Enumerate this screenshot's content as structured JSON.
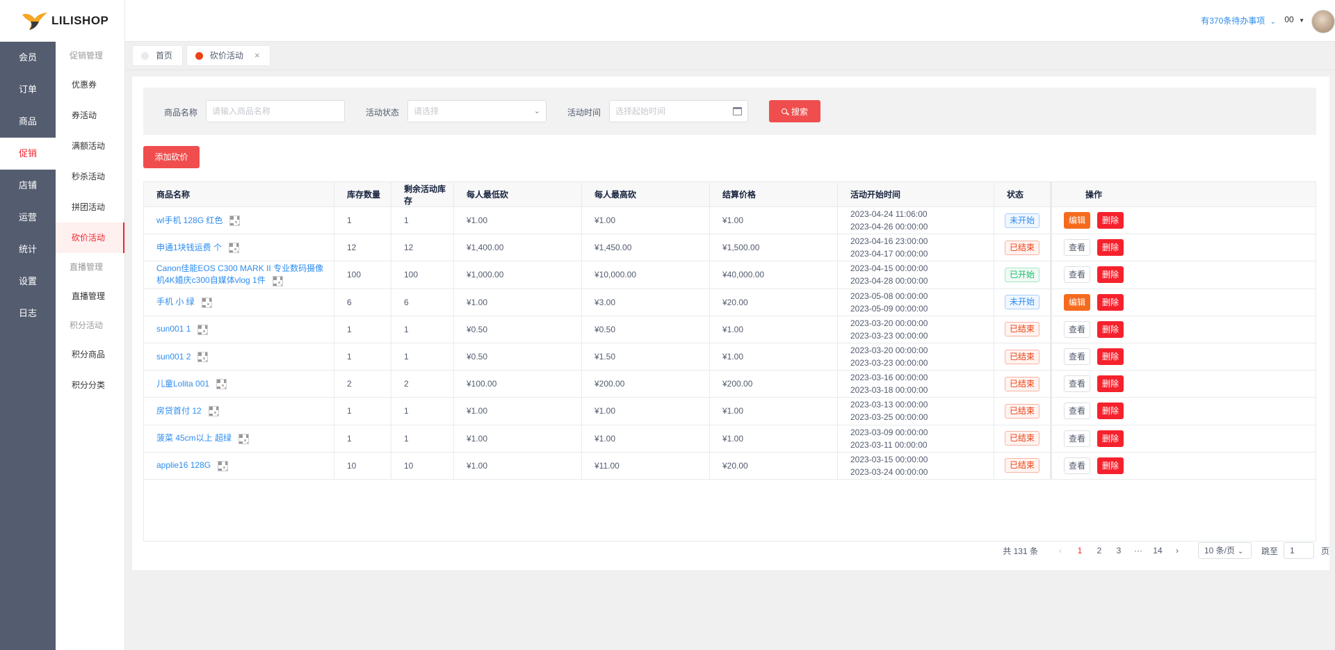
{
  "brand": {
    "name": "LILISHOP"
  },
  "header": {
    "todo": "有370条待办事项",
    "user": "00"
  },
  "nav": {
    "items": [
      {
        "label": "会员",
        "active": false
      },
      {
        "label": "订单",
        "active": false
      },
      {
        "label": "商品",
        "active": false
      },
      {
        "label": "促销",
        "active": true
      },
      {
        "label": "店铺",
        "active": false
      },
      {
        "label": "运营",
        "active": false
      },
      {
        "label": "统计",
        "active": false
      },
      {
        "label": "设置",
        "active": false
      },
      {
        "label": "日志",
        "active": false
      }
    ]
  },
  "subnav": {
    "groups": [
      {
        "title": "促销管理",
        "items": [
          "优惠券",
          "券活动",
          "满额活动",
          "秒杀活动",
          "拼团活动",
          "砍价活动"
        ]
      },
      {
        "title": "直播管理",
        "items": [
          "直播管理"
        ]
      },
      {
        "title": "积分活动",
        "items": [
          "积分商品",
          "积分分类"
        ]
      }
    ],
    "active": "砍价活动"
  },
  "tabs": [
    {
      "label": "首页",
      "closable": false
    },
    {
      "label": "砍价活动",
      "closable": true,
      "close": "×"
    }
  ],
  "search": {
    "name_label": "商品名称",
    "name_placeholder": "请输入商品名称",
    "status_label": "活动状态",
    "status_placeholder": "请选择",
    "time_label": "活动时间",
    "time_placeholder": "选择起始时间",
    "search_button": "搜索"
  },
  "add_button": "添加砍价",
  "table": {
    "columns": [
      "商品名称",
      "库存数量",
      "剩余活动库存",
      "每人最低砍",
      "每人最高砍",
      "结算价格",
      "活动开始时间",
      "状态",
      "操作"
    ],
    "rows": [
      {
        "name": "wl手机 128G 红色",
        "stock": "1",
        "remain": "1",
        "min": "¥1.00",
        "max": "¥1.00",
        "price": "¥1.00",
        "start": "2023-04-24 11:06:00",
        "end": "2023-04-26 00:00:00",
        "status": "未开始",
        "status_color": "blue",
        "op": "编辑",
        "op_type": "edit",
        "del": "删除"
      },
      {
        "name": "申通1块钱运费 个",
        "stock": "12",
        "remain": "12",
        "min": "¥1,400.00",
        "max": "¥1,450.00",
        "price": "¥1,500.00",
        "start": "2023-04-16 23:00:00",
        "end": "2023-04-17 00:00:00",
        "status": "已结束",
        "status_color": "red",
        "op": "查看",
        "op_type": "view",
        "del": "删除"
      },
      {
        "name": "Canon佳能EOS C300 MARK II 专业数码摄像机4K婚庆c300自媒体vlog 1件",
        "stock": "100",
        "remain": "100",
        "min": "¥1,000.00",
        "max": "¥10,000.00",
        "price": "¥40,000.00",
        "start": "2023-04-15 00:00:00",
        "end": "2023-04-28 00:00:00",
        "status": "已开始",
        "status_color": "green",
        "op": "查看",
        "op_type": "view",
        "del": "删除"
      },
      {
        "name": "手机 小 绿",
        "stock": "6",
        "remain": "6",
        "min": "¥1.00",
        "max": "¥3.00",
        "price": "¥20.00",
        "start": "2023-05-08 00:00:00",
        "end": "2023-05-09 00:00:00",
        "status": "未开始",
        "status_color": "blue",
        "op": "编辑",
        "op_type": "edit",
        "del": "删除"
      },
      {
        "name": "sun001 1",
        "stock": "1",
        "remain": "1",
        "min": "¥0.50",
        "max": "¥0.50",
        "price": "¥1.00",
        "start": "2023-03-20 00:00:00",
        "end": "2023-03-23 00:00:00",
        "status": "已结束",
        "status_color": "red",
        "op": "查看",
        "op_type": "view",
        "del": "删除"
      },
      {
        "name": "sun001 2",
        "stock": "1",
        "remain": "1",
        "min": "¥0.50",
        "max": "¥1.50",
        "price": "¥1.00",
        "start": "2023-03-20 00:00:00",
        "end": "2023-03-23 00:00:00",
        "status": "已结束",
        "status_color": "red",
        "op": "查看",
        "op_type": "view",
        "del": "删除"
      },
      {
        "name": "儿童Lolita 001",
        "stock": "2",
        "remain": "2",
        "min": "¥100.00",
        "max": "¥200.00",
        "price": "¥200.00",
        "start": "2023-03-16 00:00:00",
        "end": "2023-03-18 00:00:00",
        "status": "已结束",
        "status_color": "red",
        "op": "查看",
        "op_type": "view",
        "del": "删除"
      },
      {
        "name": "房贷首付 12",
        "stock": "1",
        "remain": "1",
        "min": "¥1.00",
        "max": "¥1.00",
        "price": "¥1.00",
        "start": "2023-03-13 00:00:00",
        "end": "2023-03-25 00:00:00",
        "status": "已结束",
        "status_color": "red",
        "op": "查看",
        "op_type": "view",
        "del": "删除"
      },
      {
        "name": "菠菜 45cm以上 超绿",
        "stock": "1",
        "remain": "1",
        "min": "¥1.00",
        "max": "¥1.00",
        "price": "¥1.00",
        "start": "2023-03-09 00:00:00",
        "end": "2023-03-11 00:00:00",
        "status": "已结束",
        "status_color": "red",
        "op": "查看",
        "op_type": "view",
        "del": "删除"
      },
      {
        "name": "applie16 128G",
        "stock": "10",
        "remain": "10",
        "min": "¥1.00",
        "max": "¥11.00",
        "price": "¥20.00",
        "start": "2023-03-15 00:00:00",
        "end": "2023-03-24 00:00:00",
        "status": "已结束",
        "status_color": "red",
        "op": "查看",
        "op_type": "view",
        "del": "删除"
      }
    ]
  },
  "pagination": {
    "total": "共 131 条",
    "prev": "‹",
    "next": "›",
    "pages": [
      "1",
      "2",
      "3",
      "···",
      "14"
    ],
    "current": "1",
    "page_size": "10 条/页",
    "jump_label": "跳至",
    "jump_value": "1",
    "page_suffix": "页"
  },
  "colors": {
    "accent": "#f04e4e",
    "sidebar": "#545c6f",
    "link": "#2d8cf0"
  }
}
